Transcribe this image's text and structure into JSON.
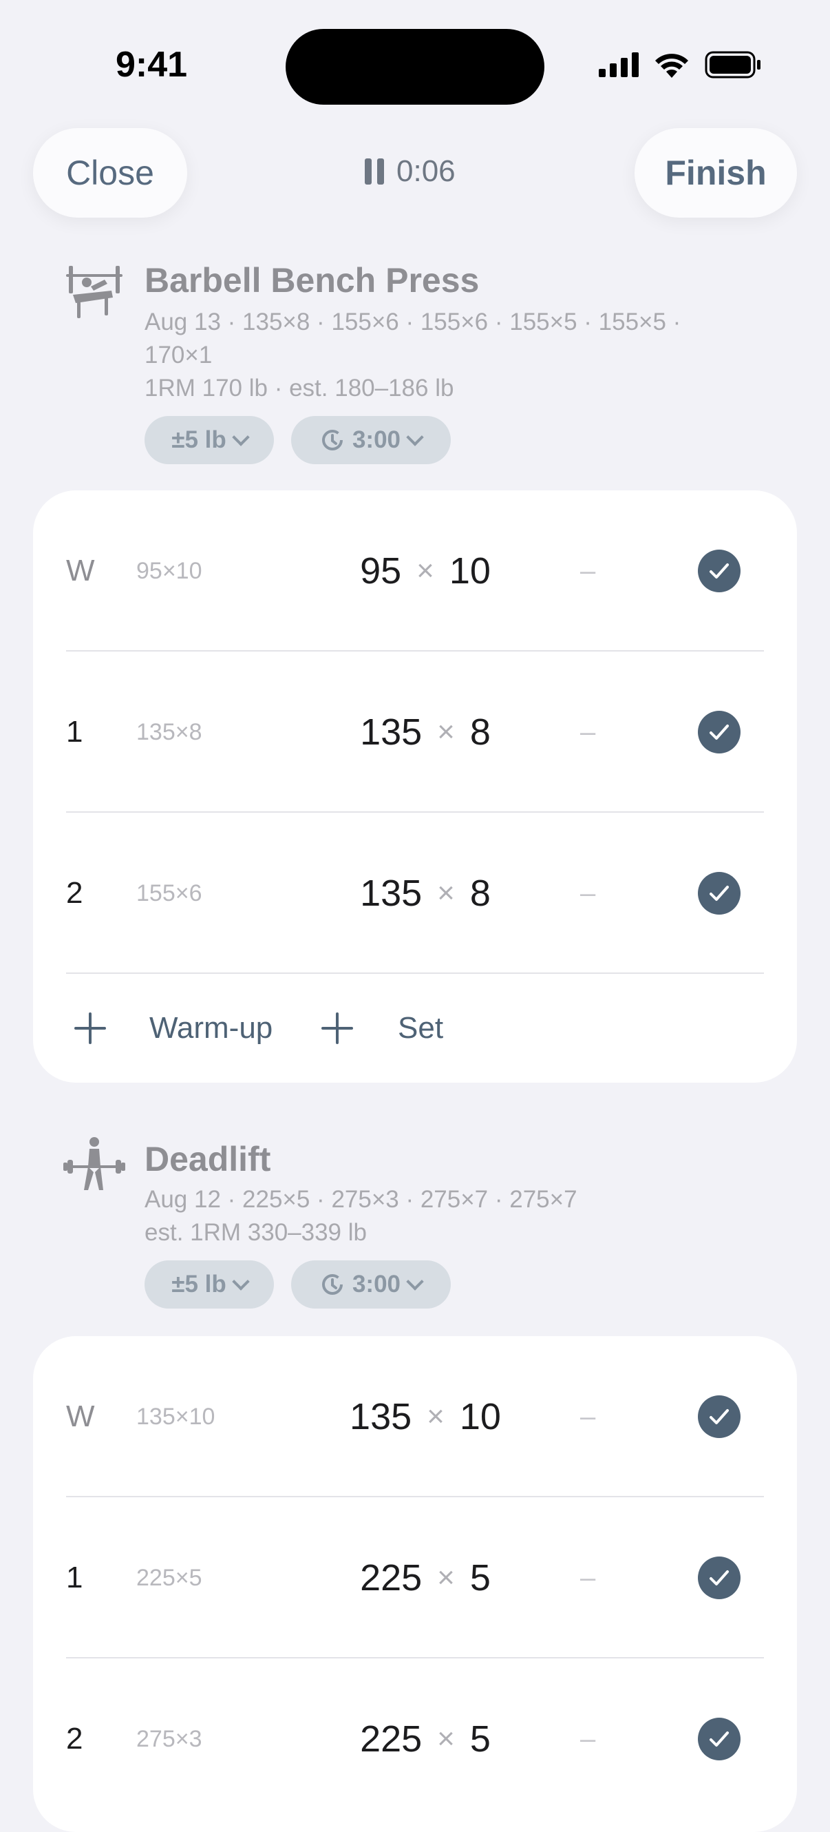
{
  "status_bar": {
    "time": "9:41"
  },
  "header": {
    "close_label": "Close",
    "finish_label": "Finish",
    "timer": "0:06"
  },
  "colors": {
    "accent": "#4e6275",
    "background": "#f2f2f7",
    "chip": "#d7dde3"
  },
  "exercises": [
    {
      "icon": "bench-press-icon",
      "name": "Barbell Bench Press",
      "history_line1": "Aug 13 · 135×8 · 155×6 · 155×6 · 155×5 · 155×5 ·",
      "history_line2": "170×1",
      "history_line3": "1RM 170 lb · est. 180–186 lb",
      "increment_chip": "±5 lb",
      "rest_chip": "3:00",
      "sets": [
        {
          "label": "W",
          "previous": "95×10",
          "weight": "95",
          "reps": "10",
          "rpe": "–"
        },
        {
          "label": "1",
          "previous": "135×8",
          "weight": "135",
          "reps": "8",
          "rpe": "–"
        },
        {
          "label": "2",
          "previous": "155×6",
          "weight": "135",
          "reps": "8",
          "rpe": "–"
        }
      ],
      "add_warmup_label": "Warm-up",
      "add_set_label": "Set"
    },
    {
      "icon": "deadlift-icon",
      "name": "Deadlift",
      "history_line1": "Aug 12 · 225×5 · 275×3 · 275×7 · 275×7",
      "history_line2": "est. 1RM 330–339 lb",
      "increment_chip": "±5 lb",
      "rest_chip": "3:00",
      "sets": [
        {
          "label": "W",
          "previous": "135×10",
          "weight": "135",
          "reps": "10",
          "rpe": "–"
        },
        {
          "label": "1",
          "previous": "225×5",
          "weight": "225",
          "reps": "5",
          "rpe": "–"
        },
        {
          "label": "2",
          "previous": "275×3",
          "weight": "225",
          "reps": "5",
          "rpe": "–"
        }
      ]
    }
  ],
  "multiply_sign": "×"
}
